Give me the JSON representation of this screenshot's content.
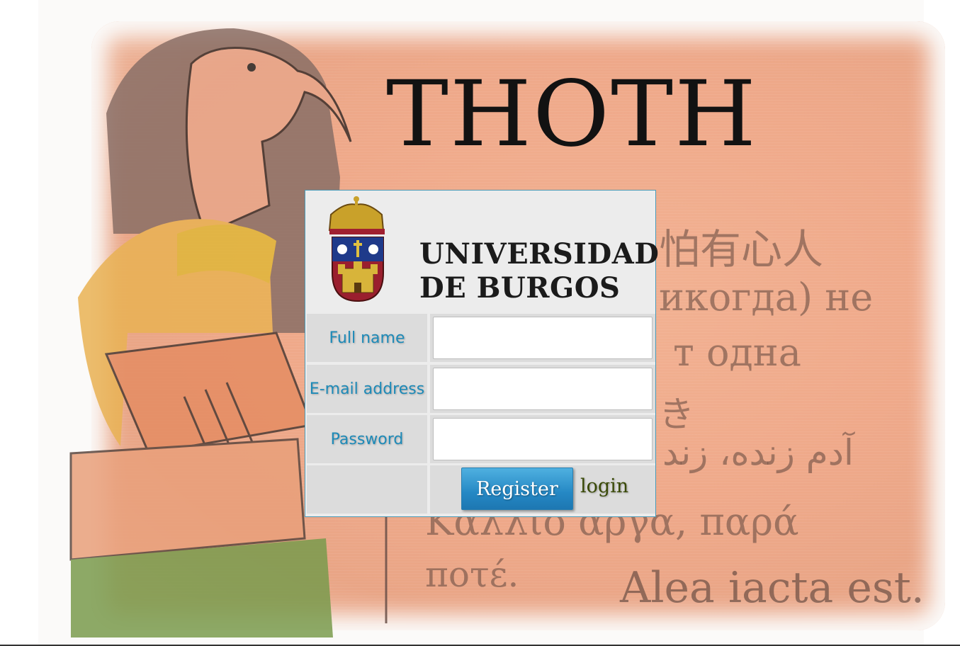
{
  "background": {
    "title": "THOTH",
    "lines": {
      "chinese": "怕有心人",
      "russian1": "икогда) не",
      "russian2": "т одна",
      "misc": "き",
      "arabic": "آدم زنده، زند",
      "greek1": "Κάλλιο άργα, παρά",
      "greek2": "ποτέ.",
      "latin": "Alea iacta est."
    }
  },
  "logo": {
    "line1": "UNIVERSIDAD",
    "line2": "DE BURGOS"
  },
  "form": {
    "full_name_label": "Full name",
    "email_label": "E-mail address",
    "password_label": "Password",
    "full_name_value": "",
    "email_value": "",
    "password_value": "",
    "register_label": "Register",
    "login_label": "login"
  },
  "colors": {
    "label_text": "#1d8ab8",
    "button": "#2588c4",
    "panel_border": "#4a9bb8",
    "login_link": "#3a4a08"
  }
}
